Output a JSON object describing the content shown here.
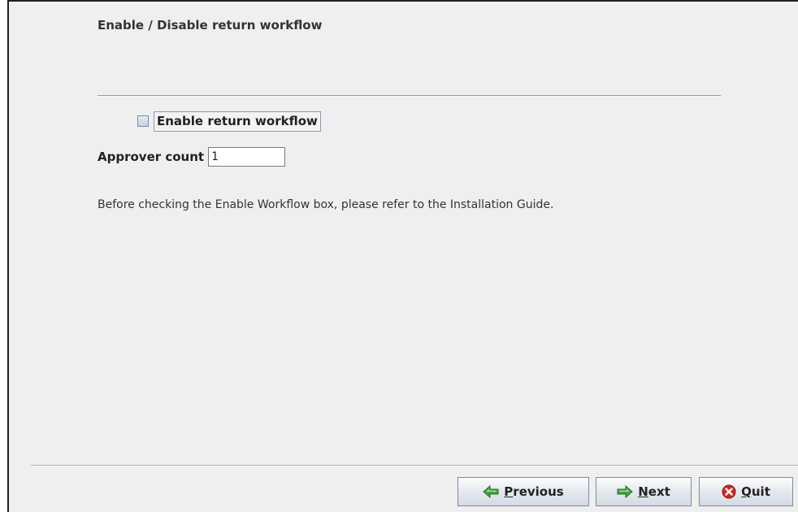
{
  "page": {
    "title": "Enable / Disable return workflow"
  },
  "workflow": {
    "enable_label": "Enable return workflow",
    "enable_checked": false,
    "approver_label": "Approver count",
    "approver_value": "1",
    "info_text": "Before checking the Enable Workflow box, please refer to the Installation Guide."
  },
  "buttons": {
    "previous": {
      "mnemonic": "P",
      "rest": "revious",
      "icon": "arrow-left-icon"
    },
    "next": {
      "mnemonic": "N",
      "rest": "ext",
      "icon": "arrow-right-icon"
    },
    "quit": {
      "mnemonic": "Q",
      "rest": "uit",
      "icon": "stop-icon"
    }
  },
  "colors": {
    "arrow_green": "#3fa33f",
    "quit_red": "#d9241f"
  }
}
